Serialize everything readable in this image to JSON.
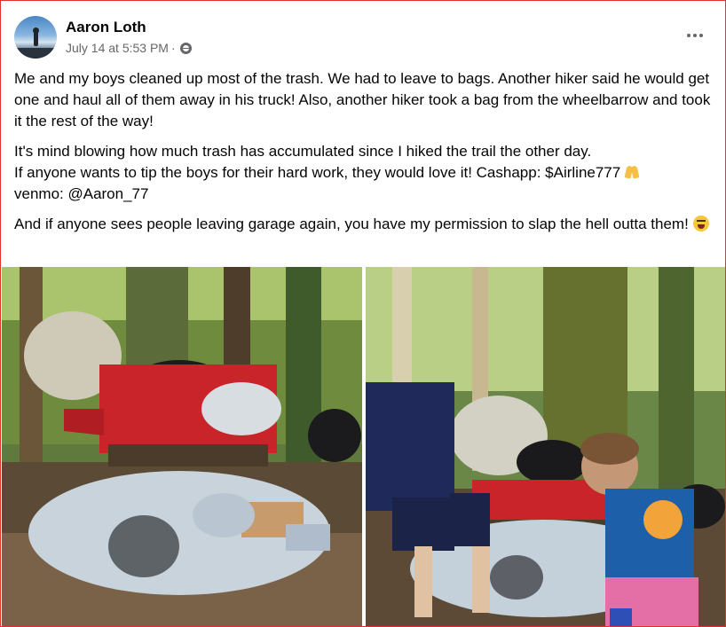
{
  "post": {
    "author": "Aaron Loth",
    "timestamp": "July 14 at 5:53 PM",
    "separator": "·",
    "audience_icon": "public-globe-icon",
    "more_icon": "more-options-icon",
    "paragraphs": {
      "p1": "Me and my boys cleaned up most of the trash. We had to leave to bags. Another hiker said he would get one and haul all of them away in his truck! Also, another hiker took a bag from the wheelbarrow and took it the rest of the way!",
      "p2_line1": "It's mind blowing how much trash has accumulated since I hiked the trail the other day.",
      "p2_line2": "If anyone wants to tip the boys for their hard work, they would love it! Cashapp: $Airline777",
      "p2_line3": "venmo: @Aaron_77",
      "p3": "And if anyone sees people leaving garage again, you have my permission to slap the hell outta them!"
    },
    "emojis": {
      "praying": "praying-hands-emoji",
      "laughing": "squinting-tongue-emoji"
    },
    "photos": [
      {
        "name": "trash-pile-photo",
        "alt": ""
      },
      {
        "name": "kids-cleaning-photo",
        "alt": ""
      }
    ]
  },
  "colors": {
    "text_primary": "#050505",
    "text_secondary": "#65676b",
    "frame_border": "#e03030",
    "wheelbarrow_red": "#c8242a"
  }
}
